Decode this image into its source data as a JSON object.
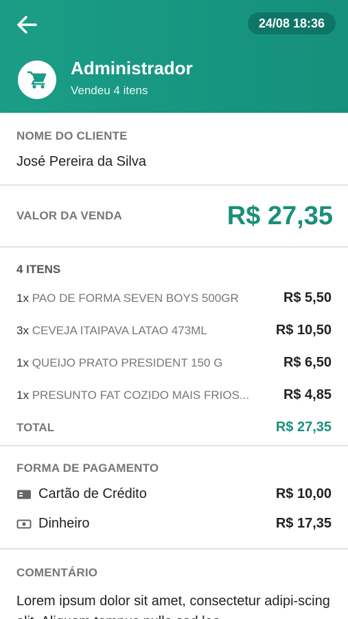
{
  "header": {
    "datetime": "24/08 18:36",
    "user_name": "Administrador",
    "user_subtitle": "Vendeu 4 itens",
    "back_icon": "arrow-left-icon",
    "avatar_icon": "shopping-cart-icon",
    "colors": {
      "primary": "#1a9d86",
      "badge": "#0f7566"
    }
  },
  "client": {
    "label": "NOME DO CLIENTE",
    "name": "José Pereira da Silva"
  },
  "sale": {
    "label": "VALOR DA VENDA",
    "amount": "R$ 27,35"
  },
  "items": {
    "count_label": "4 ITENS",
    "list": [
      {
        "qty": "1x",
        "name": "PAO DE FORMA SEVEN BOYS 500GR",
        "price": "R$ 5,50"
      },
      {
        "qty": "3x",
        "name": "CEVEJA ITAIPAVA LATAO  473ML",
        "price": "R$ 10,50"
      },
      {
        "qty": "1x",
        "name": "QUEIJO PRATO PRESIDENT 150 G",
        "price": "R$ 6,50"
      },
      {
        "qty": "1x",
        "name": "PRESUNTO FAT COZIDO MAIS FRIOS...",
        "price": "R$ 4,85"
      }
    ],
    "total_label": "TOTAL",
    "total_value": "R$ 27,35"
  },
  "payment": {
    "label": "FORMA DE PAGAMENTO",
    "methods": [
      {
        "icon": "credit-card-icon",
        "name": "Cartão de Crédito",
        "value": "R$ 10,00"
      },
      {
        "icon": "cash-icon",
        "name": "Dinheiro",
        "value": "R$ 17,35"
      }
    ]
  },
  "comment": {
    "label": "COMENTÁRIO",
    "text": "Lorem ipsum dolor sit amet, consectetur adipi-scing elit. Aliquam tempus nulla sed leo"
  }
}
